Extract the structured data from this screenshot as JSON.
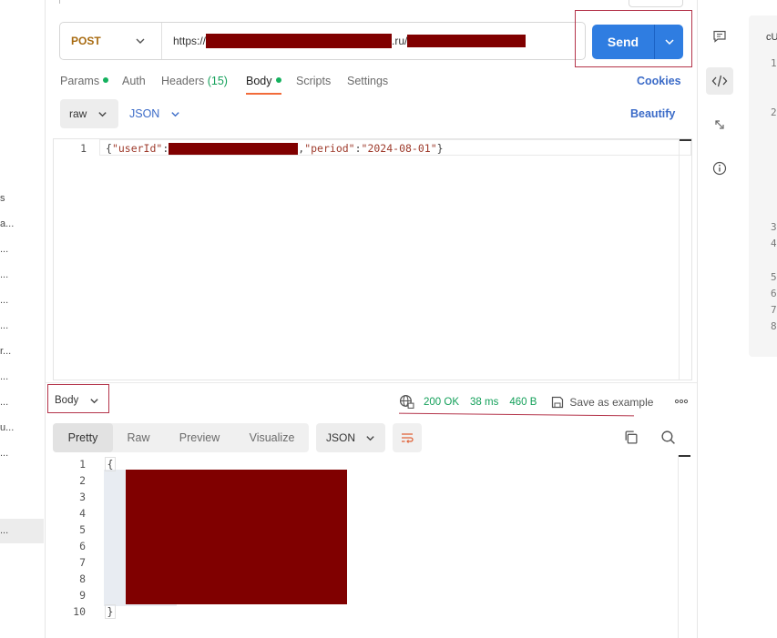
{
  "sidebar": {
    "items": [
      {
        "label": "s",
        "active": false
      },
      {
        "label": "a...",
        "active": false
      },
      {
        "label": "...",
        "active": false
      },
      {
        "label": "...",
        "active": false
      },
      {
        "label": "...",
        "active": false
      },
      {
        "label": "...",
        "active": false
      },
      {
        "label": "r...",
        "active": false
      },
      {
        "label": "...",
        "active": false
      },
      {
        "label": "...",
        "active": false
      },
      {
        "label": "u...",
        "active": false
      },
      {
        "label": "...",
        "active": false
      },
      {
        "label": "...",
        "active": true
      }
    ]
  },
  "request": {
    "method": "POST",
    "url_prefix": "https://",
    "url_mid": ".ru/",
    "send_label": "Send"
  },
  "tabs": {
    "params": "Params",
    "auth": "Auth",
    "headers": "Headers",
    "headers_count": "(15)",
    "body": "Body",
    "scripts": "Scripts",
    "settings": "Settings",
    "cookies": "Cookies"
  },
  "body_toolbar": {
    "mode": "raw",
    "language": "JSON",
    "beautify": "Beautify"
  },
  "editor": {
    "line_number": "1",
    "open": "{",
    "key1": "\"userId\"",
    "colon": ":",
    "comma": ",",
    "key2": "\"period\"",
    "value2": "\"2024-08-01\"",
    "close": "}"
  },
  "response": {
    "body_label": "Body",
    "status": "200 OK",
    "time": "38 ms",
    "size": "460 B",
    "save_example": "Save as example",
    "view_tabs": [
      "Pretty",
      "Raw",
      "Preview",
      "Visualize"
    ],
    "language": "JSON",
    "line_numbers": [
      "1",
      "2",
      "3",
      "4",
      "5",
      "6",
      "7",
      "8",
      "9",
      "10"
    ],
    "open": "{",
    "close": "}"
  },
  "right_panel": {
    "title": "cU",
    "line_numbers": [
      "1",
      "2",
      "3",
      "4",
      "5",
      "6",
      "7",
      "8"
    ]
  },
  "colors": {
    "accent": "#2f7de1",
    "method": "#a86b11",
    "success": "#14a05a",
    "redaction": "#800000",
    "tab_underline": "#f26b3a"
  }
}
